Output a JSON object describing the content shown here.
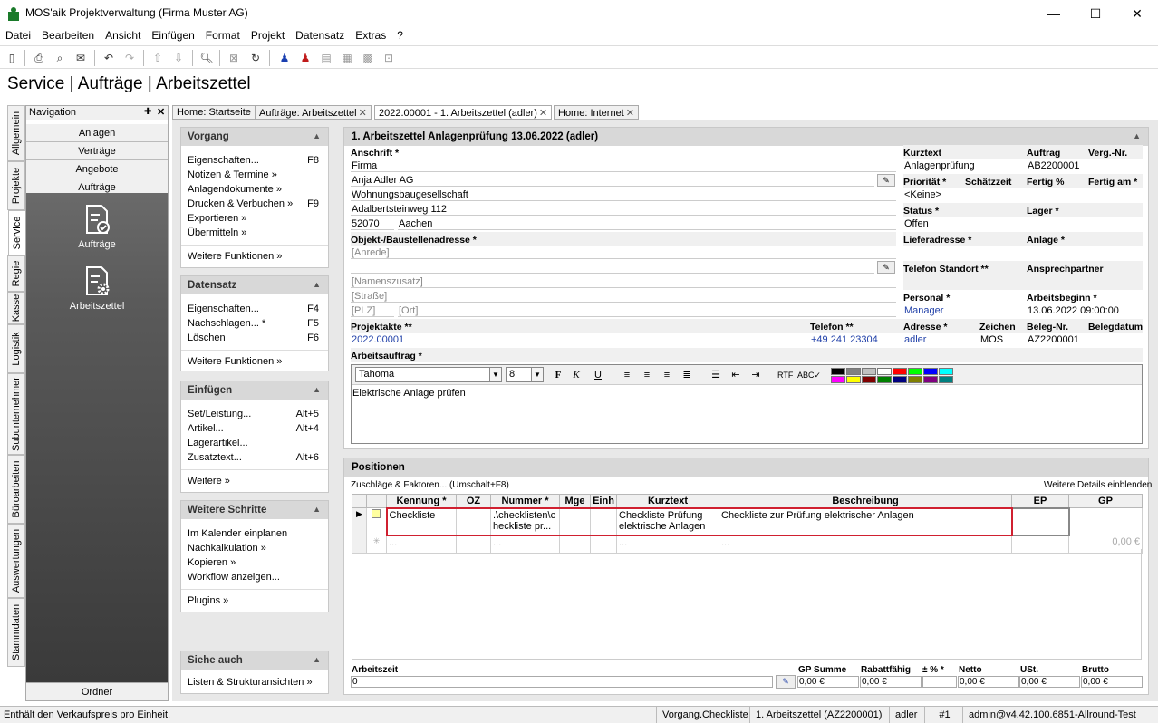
{
  "window": {
    "title": "MOS'aik Projektverwaltung (Firma Muster AG)",
    "minimize": "—",
    "maximize": "☐",
    "close": "✕"
  },
  "menu": [
    "Datei",
    "Bearbeiten",
    "Ansicht",
    "Einfügen",
    "Format",
    "Projekt",
    "Datensatz",
    "Extras",
    "?"
  ],
  "heading": "Service | Aufträge | Arbeitszettel",
  "vertical_tabs": [
    "Allgemein",
    "Projekte",
    "Service",
    "Regie",
    "Kasse",
    "Logistik",
    "Subunternehmer",
    "Büroarbeiten",
    "Auswertungen",
    "Stammdaten"
  ],
  "navigation": {
    "title": "Navigation",
    "pin": "✚",
    "close": "✕",
    "buttons": [
      "Anlagen",
      "Verträge",
      "Angebote",
      "Aufträge"
    ],
    "items": [
      "Aufträge",
      "Arbeitszettel"
    ],
    "footer": "Ordner"
  },
  "doc_tabs": [
    {
      "label": "Home: Startseite",
      "closable": false
    },
    {
      "label": "Aufträge: Arbeitszettel",
      "closable": true
    },
    {
      "label": "2022.00001 - 1. Arbeitszettel (adler)",
      "closable": true
    },
    {
      "label": "Home: Internet",
      "closable": true
    }
  ],
  "panels": {
    "vorgang": {
      "title": "Vorgang",
      "rows": [
        {
          "label": "Eigenschaften...",
          "key": "F8"
        },
        {
          "label": "Notizen & Termine »",
          "key": ""
        },
        {
          "label": "Anlagendokumente »",
          "key": ""
        },
        {
          "label": "Drucken & Verbuchen »",
          "key": "F9"
        },
        {
          "label": "Exportieren »",
          "key": ""
        },
        {
          "label": "Übermitteln »",
          "key": ""
        }
      ],
      "more": "Weitere Funktionen »"
    },
    "datensatz": {
      "title": "Datensatz",
      "rows": [
        {
          "label": "Eigenschaften...",
          "key": "F4"
        },
        {
          "label": "Nachschlagen... *",
          "key": "F5"
        },
        {
          "label": "Löschen",
          "key": "F6"
        }
      ],
      "more": "Weitere Funktionen »"
    },
    "einfuegen": {
      "title": "Einfügen",
      "rows": [
        {
          "label": "Set/Leistung...",
          "key": "Alt+5"
        },
        {
          "label": "Artikel...",
          "key": "Alt+4"
        },
        {
          "label": "Lagerartikel...",
          "key": ""
        },
        {
          "label": "Zusatztext...",
          "key": "Alt+6"
        }
      ],
      "more": "Weitere »"
    },
    "schritte": {
      "title": "Weitere Schritte",
      "rows": [
        {
          "label": "Im Kalender einplanen",
          "key": ""
        },
        {
          "label": "Nachkalkulation »",
          "key": ""
        },
        {
          "label": "Kopieren »",
          "key": ""
        },
        {
          "label": "Workflow anzeigen...",
          "key": ""
        }
      ],
      "more": "Plugins »"
    },
    "siehe": {
      "title": "Siehe auch",
      "rows": [
        {
          "label": "Listen & Strukturansichten »",
          "key": ""
        }
      ]
    }
  },
  "form": {
    "header": "1. Arbeitszettel Anlagenprüfung 13.06.2022 (adler)",
    "anschrift": {
      "label": "Anschrift *",
      "line1": "Firma",
      "line2": "Anja Adler AG",
      "line3": "Wohnungsbaugesellschaft",
      "line4": "Adalbertsteinweg 112",
      "plz": "52070",
      "ort": "Aachen"
    },
    "objekt": {
      "label": "Objekt-/Baustellenadresse *",
      "anrede": "[Anrede]",
      "name": "",
      "zusatz": "[Namenszusatz]",
      "strasse": "[Straße]",
      "plz": "[PLZ]",
      "ort": "[Ort]"
    },
    "projektakte": {
      "label": "Projektakte **",
      "value": "2022.00001"
    },
    "telefon": {
      "label": "Telefon **",
      "value": "+49 241 23304"
    },
    "right": {
      "kurztext": {
        "label": "Kurztext",
        "value": "Anlagenprüfung"
      },
      "auftrag": {
        "label": "Auftrag",
        "value": "AB2200001"
      },
      "vergnr": {
        "label": "Verg.-Nr.",
        "value": ""
      },
      "prioritaet": {
        "label": "Priorität *",
        "value": "<Keine>"
      },
      "schaetzzeit": {
        "label": "Schätzzeit",
        "value": ""
      },
      "fertig_pct": {
        "label": "Fertig %",
        "value": ""
      },
      "fertig_am": {
        "label": "Fertig am *",
        "value": ""
      },
      "status": {
        "label": "Status *",
        "value": "Offen"
      },
      "lager": {
        "label": "Lager *",
        "value": ""
      },
      "lieferadresse": {
        "label": "Lieferadresse *",
        "value": ""
      },
      "anlage": {
        "label": "Anlage *",
        "value": ""
      },
      "telefon_standort": {
        "label": "Telefon Standort **",
        "value": ""
      },
      "ansprechpartner": {
        "label": "Ansprechpartner",
        "value": ""
      },
      "personal": {
        "label": "Personal *",
        "value": "Manager"
      },
      "arbeitsbeginn": {
        "label": "Arbeitsbeginn *",
        "value": "13.06.2022 09:00:00"
      },
      "adresse": {
        "label": "Adresse *",
        "value": "adler"
      },
      "zeichen": {
        "label": "Zeichen",
        "value": "MOS"
      },
      "belegnr": {
        "label": "Beleg-Nr.",
        "value": "AZ2200001"
      },
      "belegdatum": {
        "label": "Belegdatum",
        "value": ""
      }
    },
    "arbeitsauftrag": {
      "label": "Arbeitsauftrag *",
      "font": "Tahoma",
      "size": "8",
      "text": "Elektrische Anlage prüfen"
    }
  },
  "editor_colors": [
    "#000000",
    "#808080",
    "#c0c0c0",
    "#ffffff",
    "#ff0000",
    "#00ff00",
    "#0000ff",
    "#00ffff",
    "#ff00ff",
    "#ffff00",
    "#800000",
    "#008000",
    "#000080",
    "#808000",
    "#800080",
    "#008080"
  ],
  "positions": {
    "title": "Positionen",
    "zuschlaege": "Zuschläge & Faktoren... (Umschalt+F8)",
    "details": "Weitere Details einblenden",
    "columns": [
      "Kennung *",
      "OZ",
      "Nummer *",
      "Mge",
      "Einh",
      "Kurztext",
      "Beschreibung",
      "EP",
      "GP"
    ],
    "rows": [
      {
        "kennung": "Checkliste",
        "oz": "",
        "nummer": ".\\checklisten\\checkliste pr...",
        "mge": "",
        "einh": "",
        "kurztext": "Checkliste Prüfung elektrische Anlagen",
        "beschreibung": "Checkliste zur Prüfung elektrischer Anlagen",
        "ep": "",
        "gp": ""
      }
    ],
    "new_row": {
      "placeholder": "...",
      "gp": "0,00 €"
    }
  },
  "footer": {
    "arbeitszeit": {
      "label": "Arbeitszeit",
      "value": "0"
    },
    "gp_summe": {
      "label": "GP Summe",
      "value": "0,00 €"
    },
    "rabattfaehig": {
      "label": "Rabattfähig",
      "value": "0,00 €"
    },
    "pct": {
      "label": "± % *",
      "value": ""
    },
    "netto": {
      "label": "Netto",
      "value": "0,00 €"
    },
    "ust": {
      "label": "USt.",
      "value": "0,00 €"
    },
    "brutto": {
      "label": "Brutto",
      "value": "0,00 €"
    }
  },
  "statusbar": {
    "message": "Enthält den Verkaufspreis pro Einheit.",
    "context": "Vorgang.Checkliste",
    "document": "1. Arbeitszettel (AZ2200001)",
    "user": "adler",
    "number": "#1",
    "server": "admin@v4.42.100.6851-Allround-Test"
  }
}
